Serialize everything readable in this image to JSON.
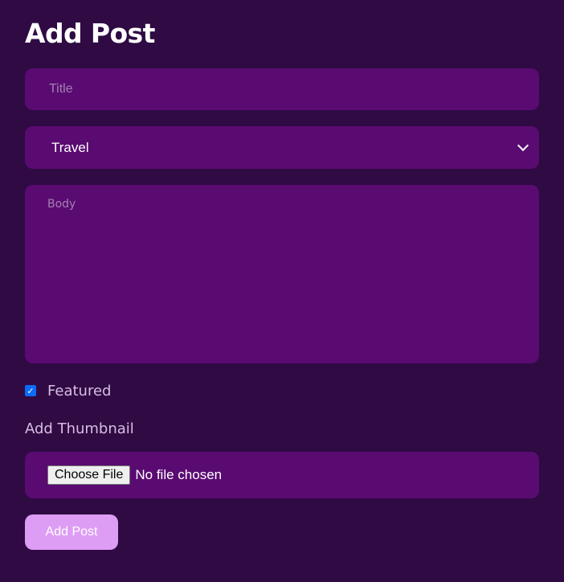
{
  "page_title": "Add Post",
  "form": {
    "title_placeholder": "Title",
    "category_selected": "Travel",
    "body_placeholder": "Body",
    "featured_label": "Featured",
    "featured_checked": true,
    "thumbnail_label": "Add Thumbnail",
    "choose_file_label": "Choose File",
    "file_status": "No file chosen",
    "submit_label": "Add Post"
  },
  "icons": {
    "select_arrow": "chevron-down-icon",
    "checkbox_mark": "checkmark-icon"
  },
  "colors": {
    "background": "#2f0a43",
    "field_bg": "#5a0b72",
    "accent_button": "#de9df5",
    "checkbox": "#0b6cf6"
  }
}
